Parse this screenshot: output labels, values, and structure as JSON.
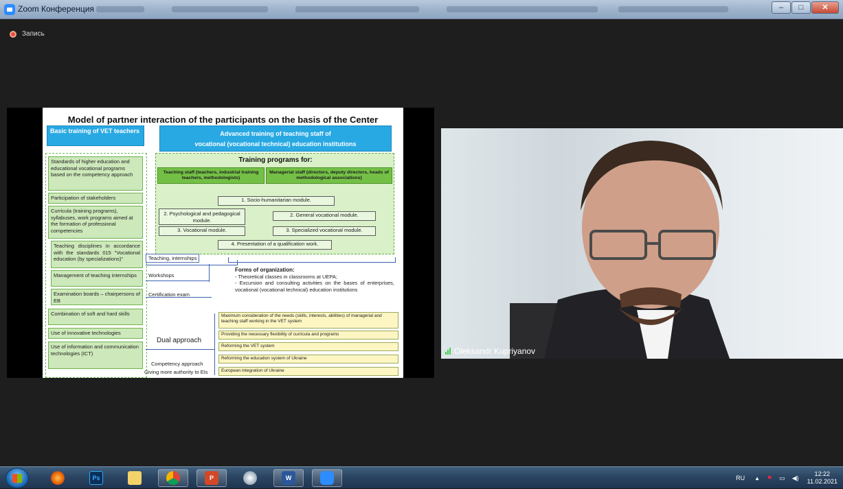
{
  "window": {
    "title": "Zoom Конференция",
    "buttons": {
      "minimize": "–",
      "maximize": "□",
      "close": "✕"
    }
  },
  "recording": {
    "label": "Запись"
  },
  "slide": {
    "title": "Model of partner interaction of the participants on the basis of the Center",
    "basic_training": "Basic training of VET teachers",
    "advanced_training_line1": "Advanced training of teaching staff of",
    "advanced_training_line2": "vocational (vocational technical) education institutions",
    "left_items": [
      "Standards of higher education and educational vocational programs based on the competency approach",
      "Participation of stakeholders",
      "Curricula (training programs), syllabuses, work programs aimed at the formation of professional competencies",
      "Teaching disciplines in accordance with the standards 015 \"Vocational education (by specializations)\"",
      "Management of teaching internships",
      "Examination boards – chairpersons of EB",
      "Combination of soft and hard skills",
      "Use of innovative technologies",
      "Use of information and communication technologies (ICT)"
    ],
    "training_programs": {
      "title": "Training programs for:",
      "teaching_staff": "Teaching staff (teachers, industrial training teachers, methodologists)",
      "managerial_staff": "Managerial staff (directors, deputy directors, heads of methodological associations)",
      "modules": {
        "m1": "1. Socio-humanitarian module.",
        "m2": "2. Psychological and pedagogical module.",
        "m2g": "2. General vocational module.",
        "m3": "3. Vocational module.",
        "m3s": "3. Specialized vocational module.",
        "m4": "4. Presentation of a qualification work."
      }
    },
    "connectors": {
      "teaching_internships": "Teaching, internships",
      "workshops": "Workshops",
      "certification": "Certification exam"
    },
    "forms": {
      "title": "Forms of organization:",
      "item1": "- Theoretical classes in classrooms at UEPA;",
      "item2": "- Excursion and consulting activities on the bases of enterprises, vocational (vocational technical) education institutions"
    },
    "goals": [
      "Maximum consideration of the needs (skills, interests, abilities) of managerial and teaching staff working in the VET system",
      "Providing the necessary flexibility of curricula and programs",
      "Reforming the VET system",
      "Reforming the education system of Ukraine",
      "European integration of Ukraine"
    ],
    "dual_approach": "Dual approach",
    "competency_approach": "Competency approach",
    "giving_authority": "Giving more authority to EIs"
  },
  "participant": {
    "name": "Oleksandr Kupriyanov"
  },
  "taskbar": {
    "apps": [
      "windows-start",
      "firefox",
      "photoshop",
      "file-explorer",
      "chrome",
      "powerpoint",
      "paint",
      "word",
      "zoom"
    ],
    "tray": {
      "language": "RU",
      "time": "12:22",
      "date": "11.02.2021"
    }
  }
}
